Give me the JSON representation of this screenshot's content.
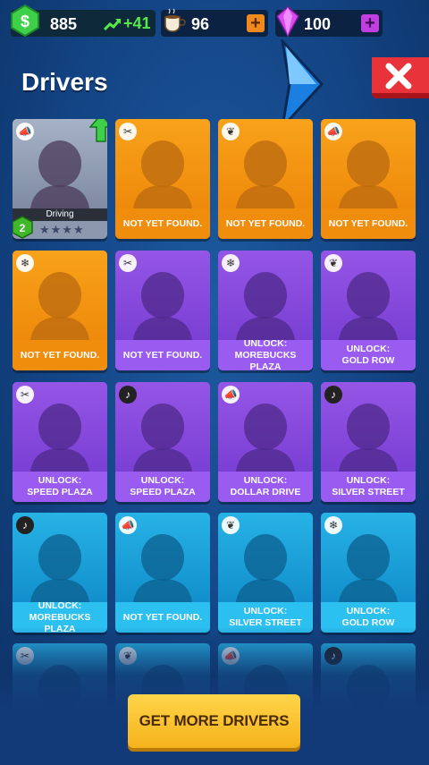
{
  "resources": {
    "cash": "885",
    "cash_rate": "+41",
    "coffee": "96",
    "gems": "100"
  },
  "header": {
    "title": "Drivers"
  },
  "active_driver": {
    "status": "Driving",
    "level": "2",
    "stars": "★★★★"
  },
  "cards": [
    {
      "label": "",
      "color": "active",
      "badge": "megaphone-icon"
    },
    {
      "label": "NOT YET FOUND.",
      "color": "orange",
      "badge": "wrench-icon"
    },
    {
      "label": "NOT YET FOUND.",
      "color": "orange",
      "badge": "leaf-icon"
    },
    {
      "label": "NOT YET FOUND.",
      "color": "orange",
      "badge": "megaphone-icon"
    },
    {
      "label": "NOT YET FOUND.",
      "color": "orange",
      "badge": "snowflake-icon"
    },
    {
      "label": "NOT YET FOUND.",
      "color": "purple",
      "badge": "wrench-icon"
    },
    {
      "label": "UNLOCK:\nMOREBUCKS PLAZA",
      "color": "purple",
      "badge": "snowflake-icon"
    },
    {
      "label": "UNLOCK:\nGOLD ROW",
      "color": "purple",
      "badge": "leaf-icon"
    },
    {
      "label": "UNLOCK:\nSPEED PLAZA",
      "color": "purple",
      "badge": "wrench-icon"
    },
    {
      "label": "UNLOCK:\nSPEED PLAZA",
      "color": "purple",
      "badge": "music-note-icon"
    },
    {
      "label": "UNLOCK:\nDOLLAR DRIVE",
      "color": "purple",
      "badge": "megaphone-icon"
    },
    {
      "label": "UNLOCK:\nSILVER STREET",
      "color": "purple",
      "badge": "music-note-icon"
    },
    {
      "label": "UNLOCK:\nMOREBUCKS PLAZA",
      "color": "blue",
      "badge": "music-note-icon"
    },
    {
      "label": "NOT YET FOUND.",
      "color": "blue",
      "badge": "megaphone-icon"
    },
    {
      "label": "UNLOCK:\nSILVER STREET",
      "color": "blue",
      "badge": "leaf-icon"
    },
    {
      "label": "UNLOCK:\nGOLD ROW",
      "color": "blue",
      "badge": "snowflake-icon"
    },
    {
      "label": "",
      "color": "blue",
      "badge": "wrench-icon"
    },
    {
      "label": "",
      "color": "blue",
      "badge": "leaf-icon"
    },
    {
      "label": "",
      "color": "blue",
      "badge": "megaphone-icon"
    },
    {
      "label": "",
      "color": "blue",
      "badge": "music-note-icon"
    }
  ],
  "cta": {
    "label": "GET MORE DRIVERS"
  },
  "colors": {
    "orange_card": "#f59a12",
    "purple_card": "#8a4be0",
    "blue_card": "#1aa4dc",
    "cta_yellow": "#ffd54a",
    "close_red": "#e8333a"
  }
}
